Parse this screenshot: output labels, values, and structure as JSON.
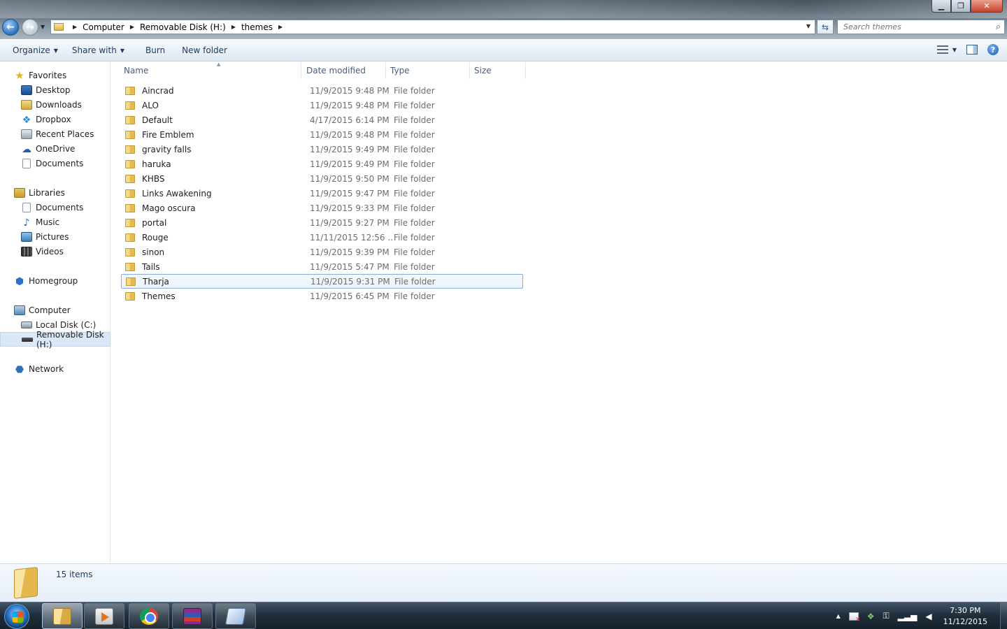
{
  "window": {
    "controls": {
      "minimize": "▁",
      "maximize": "❐",
      "close": "✕"
    }
  },
  "address": {
    "breadcrumbs": [
      "Computer",
      "Removable Disk (H:)",
      "themes"
    ],
    "search_placeholder": "Search themes"
  },
  "toolbar": {
    "organize": "Organize",
    "share_with": "Share with",
    "burn": "Burn",
    "new_folder": "New folder"
  },
  "nav": {
    "favorites": {
      "label": "Favorites",
      "items": [
        "Desktop",
        "Downloads",
        "Dropbox",
        "Recent Places",
        "OneDrive",
        "Documents"
      ]
    },
    "libraries": {
      "label": "Libraries",
      "items": [
        "Documents",
        "Music",
        "Pictures",
        "Videos"
      ]
    },
    "homegroup": "Homegroup",
    "computer": {
      "label": "Computer",
      "items": [
        "Local Disk (C:)",
        "Removable Disk (H:)"
      ]
    },
    "network": "Network"
  },
  "columns": {
    "name": "Name",
    "date": "Date modified",
    "type": "Type",
    "size": "Size"
  },
  "files": [
    {
      "name": "Aincrad",
      "date": "11/9/2015 9:48 PM",
      "type": "File folder"
    },
    {
      "name": "ALO",
      "date": "11/9/2015 9:48 PM",
      "type": "File folder"
    },
    {
      "name": "Default",
      "date": "4/17/2015 6:14 PM",
      "type": "File folder"
    },
    {
      "name": "Fire Emblem",
      "date": "11/9/2015 9:48 PM",
      "type": "File folder"
    },
    {
      "name": "gravity falls",
      "date": "11/9/2015 9:49 PM",
      "type": "File folder"
    },
    {
      "name": "haruka",
      "date": "11/9/2015 9:49 PM",
      "type": "File folder"
    },
    {
      "name": "KHBS",
      "date": "11/9/2015 9:50 PM",
      "type": "File folder"
    },
    {
      "name": "Links Awakening",
      "date": "11/9/2015 9:47 PM",
      "type": "File folder"
    },
    {
      "name": "Mago oscura",
      "date": "11/9/2015 9:33 PM",
      "type": "File folder"
    },
    {
      "name": "portal",
      "date": "11/9/2015 9:27 PM",
      "type": "File folder"
    },
    {
      "name": "Rouge",
      "date": "11/11/2015 12:56 ...",
      "type": "File folder"
    },
    {
      "name": "sinon",
      "date": "11/9/2015 9:39 PM",
      "type": "File folder"
    },
    {
      "name": "Tails",
      "date": "11/9/2015 5:47 PM",
      "type": "File folder"
    },
    {
      "name": "Tharja",
      "date": "11/9/2015 9:31 PM",
      "type": "File folder"
    },
    {
      "name": "Themes",
      "date": "11/9/2015 6:45 PM",
      "type": "File folder"
    }
  ],
  "status": {
    "item_count": "15 items"
  },
  "taskbar": {
    "clock_time": "7:30 PM",
    "clock_date": "11/12/2015"
  }
}
